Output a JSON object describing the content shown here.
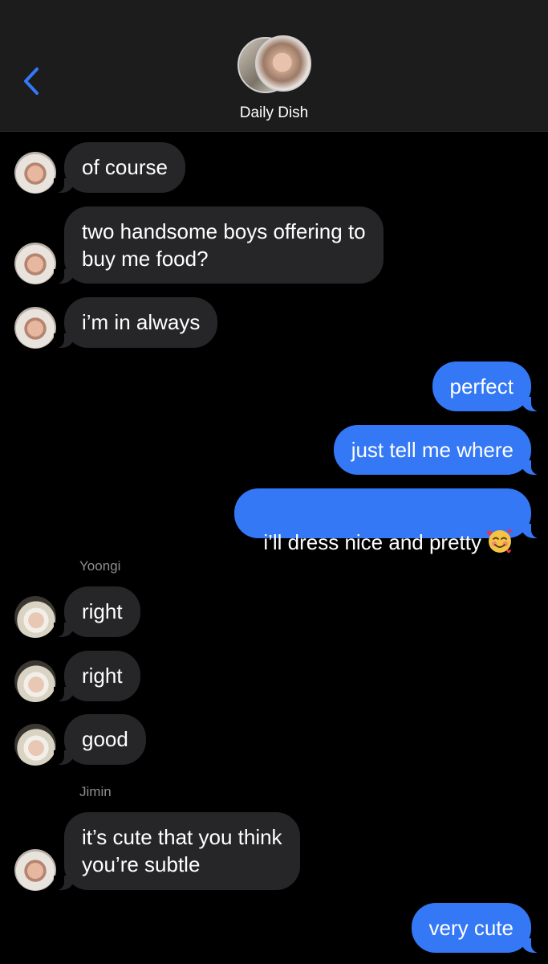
{
  "header": {
    "group_name": "Daily Dish",
    "back_icon": "chevron-left-icon"
  },
  "colors": {
    "incoming_bubble": "#262628",
    "outgoing_bubble": "#3478f6",
    "accent": "#3478f6",
    "sender_label": "#8e8e93"
  },
  "messages": [
    {
      "from": "other",
      "text": "of course"
    },
    {
      "from": "other",
      "text": "two handsome boys offering to\nbuy me food?"
    },
    {
      "from": "other",
      "text": "i’m in always"
    },
    {
      "from": "me",
      "text": "perfect"
    },
    {
      "from": "me",
      "text": "just tell me where"
    },
    {
      "from": "me",
      "text": "i’ll dress nice and pretty",
      "emoji": "smiling-face-with-hearts-icon"
    },
    {
      "sender": "Yoongi",
      "from": "other",
      "text": "right"
    },
    {
      "from": "other",
      "text": "right"
    },
    {
      "from": "other",
      "text": "good"
    },
    {
      "sender": "Jimin",
      "from": "other",
      "text": "it’s cute that you think\nyou’re subtle"
    },
    {
      "from": "me",
      "text": "very cute"
    }
  ]
}
